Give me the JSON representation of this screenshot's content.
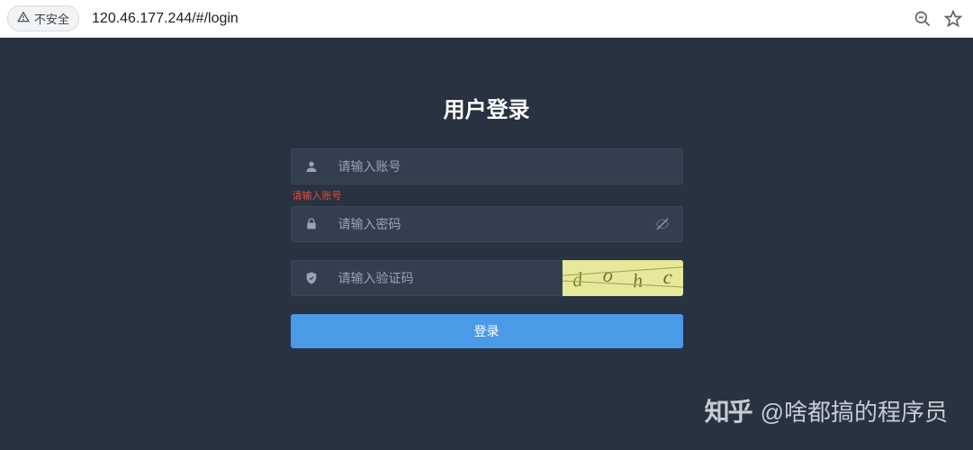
{
  "browser": {
    "security_label": "不安全",
    "url": "120.46.177.244/#/login"
  },
  "login": {
    "title": "用户登录",
    "username": {
      "placeholder": "请输入账号",
      "value": "",
      "error": "请输入账号"
    },
    "password": {
      "placeholder": "请输入密码",
      "value": ""
    },
    "captcha": {
      "placeholder": "请输入验证码",
      "value": "",
      "chars": [
        "d",
        "o",
        "h",
        "c"
      ]
    },
    "submit_label": "登录"
  },
  "watermark": {
    "logo": "知乎",
    "text": "@啥都搞的程序员"
  }
}
